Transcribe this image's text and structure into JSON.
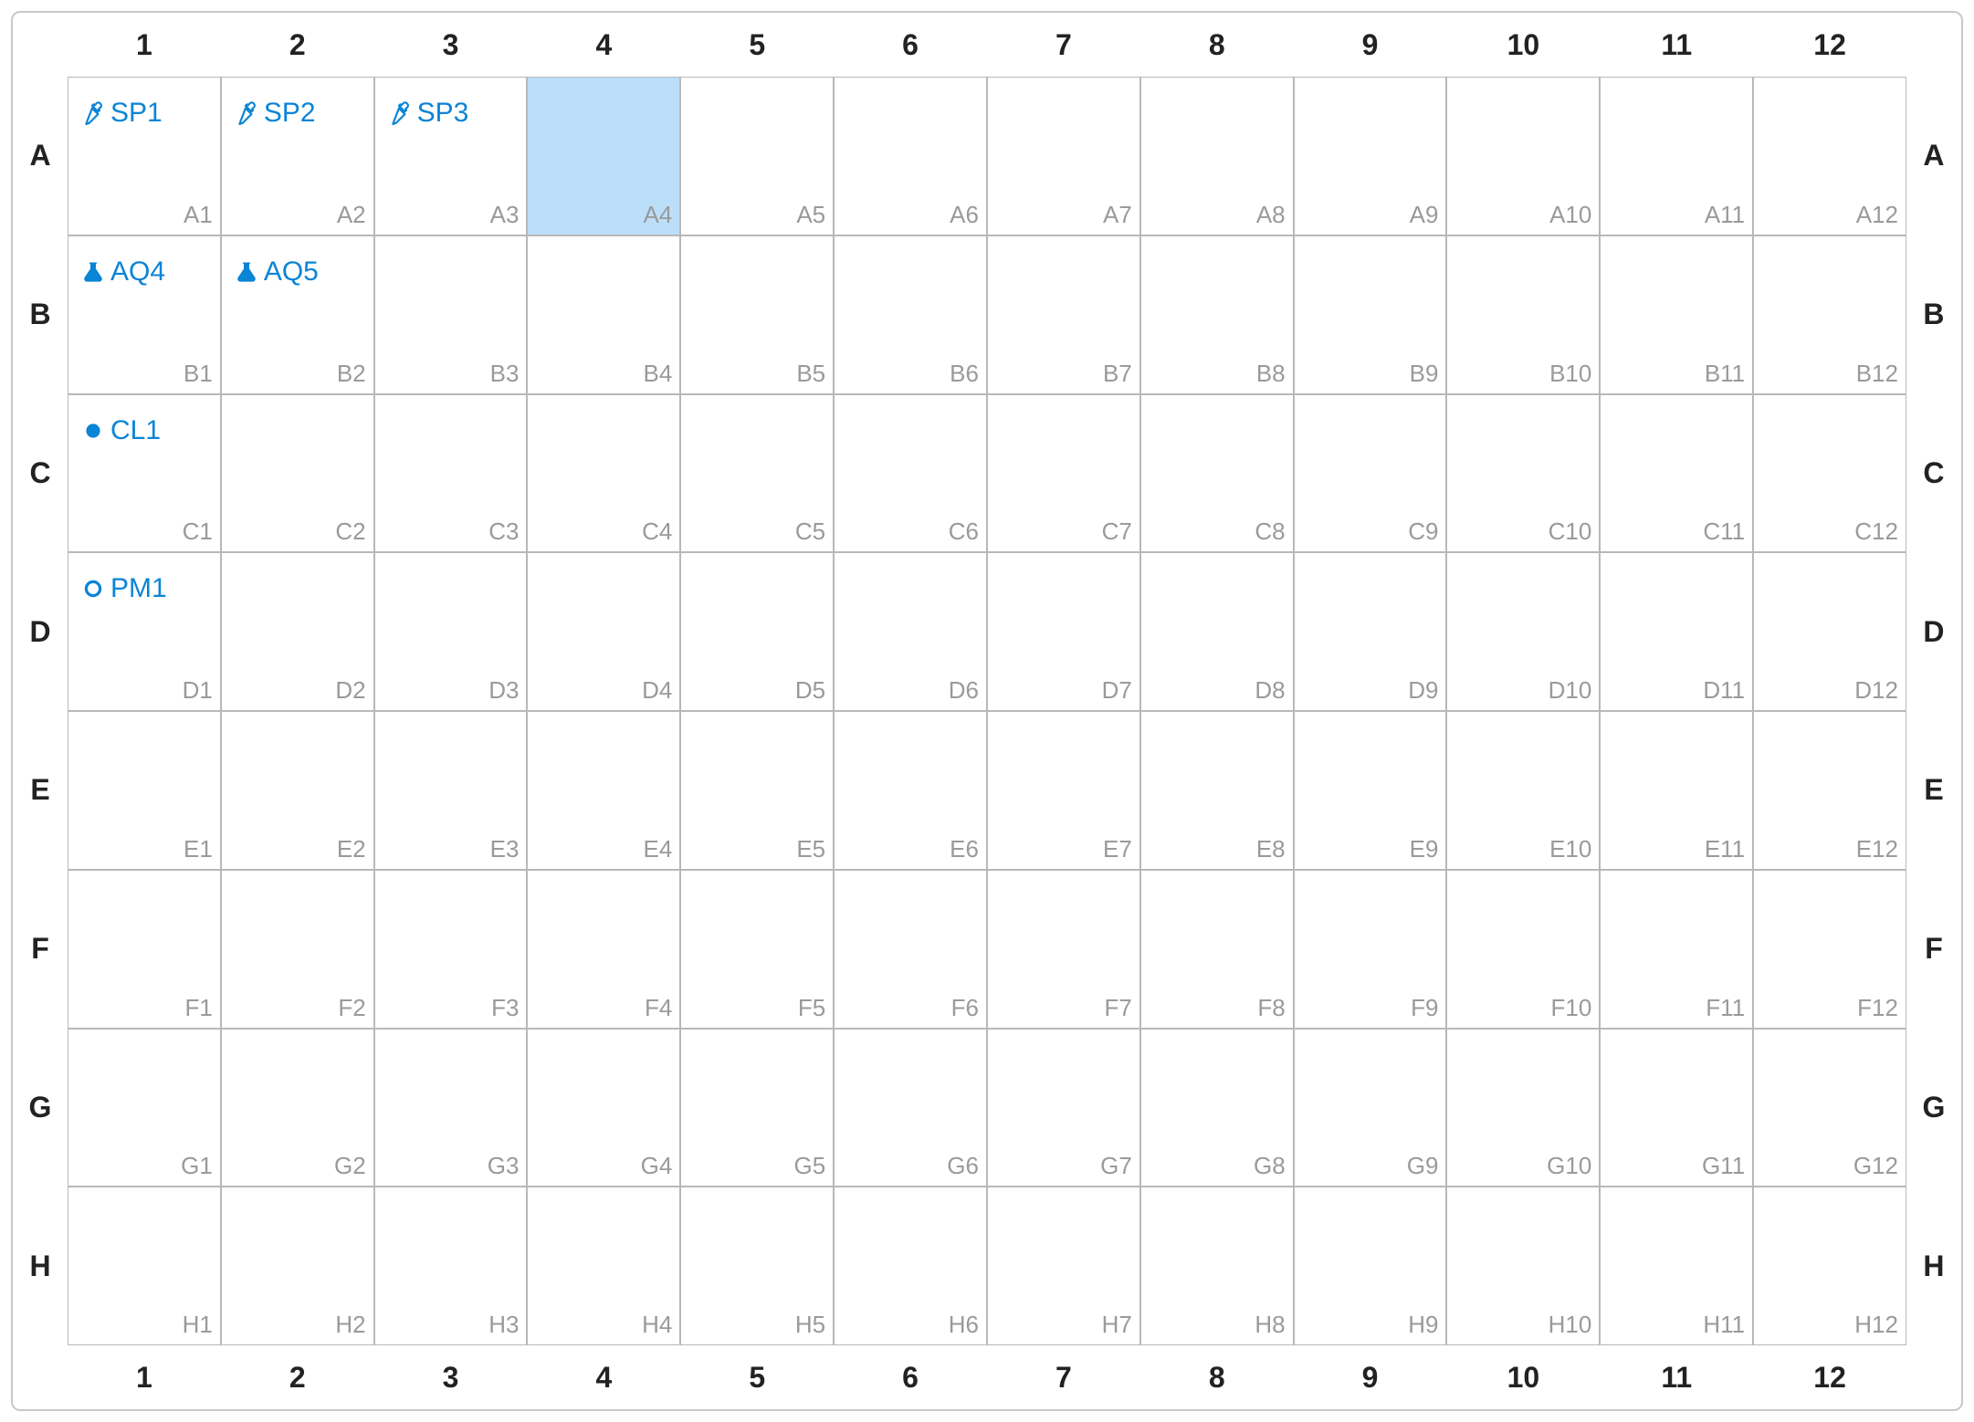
{
  "grid": {
    "rows": [
      "A",
      "B",
      "C",
      "D",
      "E",
      "F",
      "G",
      "H"
    ],
    "cols": [
      "1",
      "2",
      "3",
      "4",
      "5",
      "6",
      "7",
      "8",
      "9",
      "10",
      "11",
      "12"
    ]
  },
  "selected_well": "A4",
  "wells": {
    "A1": {
      "label": "SP1",
      "icon": "dropper"
    },
    "A2": {
      "label": "SP2",
      "icon": "dropper"
    },
    "A3": {
      "label": "SP3",
      "icon": "dropper"
    },
    "B1": {
      "label": "AQ4",
      "icon": "flask"
    },
    "B2": {
      "label": "AQ5",
      "icon": "flask"
    },
    "C1": {
      "label": "CL1",
      "icon": "dot-filled"
    },
    "D1": {
      "label": "PM1",
      "icon": "dot-open"
    }
  },
  "colors": {
    "accent": "#0a84d6",
    "selected_bg": "#bcdff9",
    "border": "#b8b8b8",
    "coord_text": "#9a9a9a"
  }
}
